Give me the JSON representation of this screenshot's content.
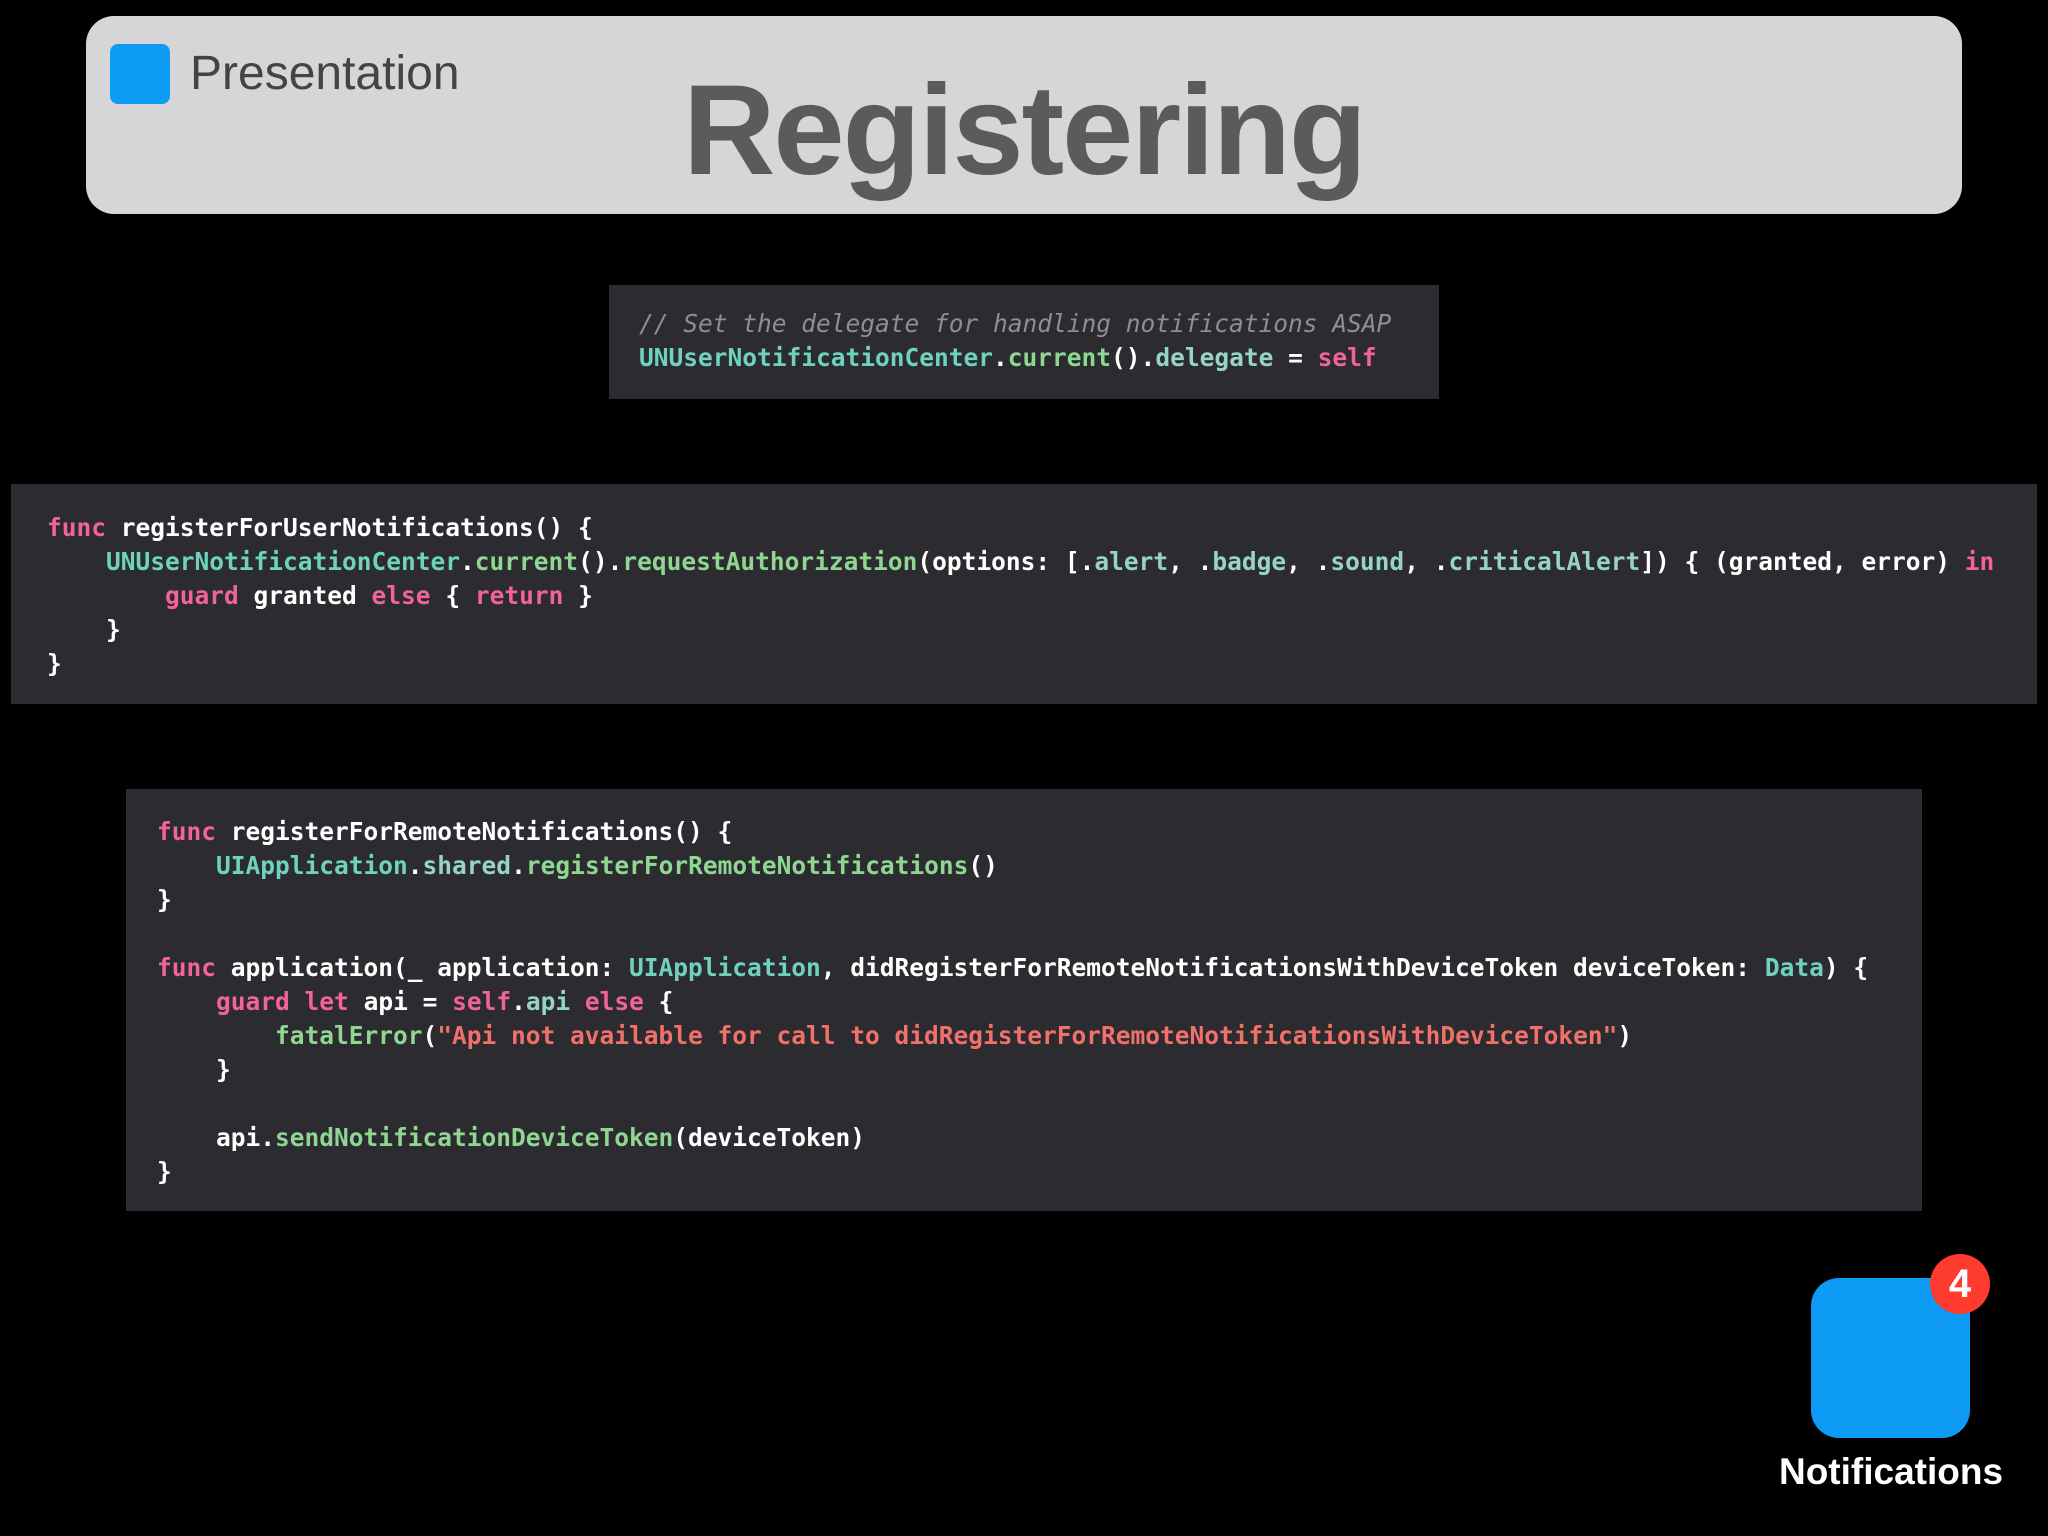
{
  "header": {
    "label": "Presentation",
    "title": "Registering"
  },
  "code_blocks": [
    {
      "id": "delegate",
      "lines": [
        [
          {
            "c": "cm",
            "t": "// Set the delegate for handling notifications ASAP"
          }
        ],
        [
          {
            "c": "t",
            "t": "UNUserNotificationCenter"
          },
          {
            "c": "w",
            "t": "."
          },
          {
            "c": "m",
            "t": "current"
          },
          {
            "c": "w",
            "t": "()."
          },
          {
            "c": "p",
            "t": "delegate"
          },
          {
            "c": "w",
            "t": " = "
          },
          {
            "c": "k",
            "t": "self"
          }
        ]
      ]
    },
    {
      "id": "register-user-notifications",
      "lines": [
        [
          {
            "c": "k",
            "t": "func"
          },
          {
            "c": "w",
            "t": " registerForUserNotifications() {"
          }
        ],
        [
          {
            "c": "w",
            "t": "    "
          },
          {
            "c": "t",
            "t": "UNUserNotificationCenter"
          },
          {
            "c": "w",
            "t": "."
          },
          {
            "c": "m",
            "t": "current"
          },
          {
            "c": "w",
            "t": "()."
          },
          {
            "c": "m",
            "t": "requestAuthorization"
          },
          {
            "c": "w",
            "t": "(options: [."
          },
          {
            "c": "p",
            "t": "alert"
          },
          {
            "c": "w",
            "t": ", ."
          },
          {
            "c": "p",
            "t": "badge"
          },
          {
            "c": "w",
            "t": ", ."
          },
          {
            "c": "p",
            "t": "sound"
          },
          {
            "c": "w",
            "t": ", ."
          },
          {
            "c": "p",
            "t": "criticalAlert"
          },
          {
            "c": "w",
            "t": "]) { (granted, error) "
          },
          {
            "c": "k",
            "t": "in"
          }
        ],
        [
          {
            "c": "w",
            "t": "        "
          },
          {
            "c": "k",
            "t": "guard"
          },
          {
            "c": "w",
            "t": " granted "
          },
          {
            "c": "k",
            "t": "else"
          },
          {
            "c": "w",
            "t": " { "
          },
          {
            "c": "k",
            "t": "return"
          },
          {
            "c": "w",
            "t": " }"
          }
        ],
        [
          {
            "c": "w",
            "t": "    }"
          }
        ],
        [
          {
            "c": "w",
            "t": "}"
          }
        ]
      ]
    },
    {
      "id": "register-remote-notifications",
      "lines": [
        [
          {
            "c": "k",
            "t": "func"
          },
          {
            "c": "w",
            "t": " registerForRemoteNotifications() {"
          }
        ],
        [
          {
            "c": "w",
            "t": "    "
          },
          {
            "c": "t",
            "t": "UIApplication"
          },
          {
            "c": "w",
            "t": "."
          },
          {
            "c": "p",
            "t": "shared"
          },
          {
            "c": "w",
            "t": "."
          },
          {
            "c": "m",
            "t": "registerForRemoteNotifications"
          },
          {
            "c": "w",
            "t": "()"
          }
        ],
        [
          {
            "c": "w",
            "t": "}"
          }
        ],
        [],
        [
          {
            "c": "k",
            "t": "func"
          },
          {
            "c": "w",
            "t": " application(_ application: "
          },
          {
            "c": "t",
            "t": "UIApplication"
          },
          {
            "c": "w",
            "t": ", didRegisterForRemoteNotificationsWithDeviceToken deviceToken: "
          },
          {
            "c": "t",
            "t": "Data"
          },
          {
            "c": "w",
            "t": ") {"
          }
        ],
        [
          {
            "c": "w",
            "t": "    "
          },
          {
            "c": "k",
            "t": "guard"
          },
          {
            "c": "w",
            "t": " "
          },
          {
            "c": "k",
            "t": "let"
          },
          {
            "c": "w",
            "t": " api = "
          },
          {
            "c": "k",
            "t": "self"
          },
          {
            "c": "w",
            "t": "."
          },
          {
            "c": "p",
            "t": "api"
          },
          {
            "c": "w",
            "t": " "
          },
          {
            "c": "k",
            "t": "else"
          },
          {
            "c": "w",
            "t": " {"
          }
        ],
        [
          {
            "c": "w",
            "t": "        "
          },
          {
            "c": "m",
            "t": "fatalError"
          },
          {
            "c": "w",
            "t": "("
          },
          {
            "c": "s",
            "t": "\"Api not available for call to didRegisterForRemoteNotificationsWithDeviceToken\""
          },
          {
            "c": "w",
            "t": ")"
          }
        ],
        [
          {
            "c": "w",
            "t": "    }"
          }
        ],
        [],
        [
          {
            "c": "w",
            "t": "    api."
          },
          {
            "c": "m",
            "t": "sendNotificationDeviceToken"
          },
          {
            "c": "w",
            "t": "(deviceToken)"
          }
        ],
        [
          {
            "c": "w",
            "t": "}"
          }
        ]
      ]
    }
  ],
  "app": {
    "badge_count": "4",
    "label": "Notifications"
  },
  "colors": {
    "accent": "#0d9bf5",
    "badge": "#ff3b2f",
    "code_background": "#2b2b30",
    "keyword": "#f2639a",
    "type": "#6ed2bf",
    "property": "#96d4c4",
    "method": "#8fd693",
    "string": "#f0706a",
    "comment": "#8b8f98"
  }
}
